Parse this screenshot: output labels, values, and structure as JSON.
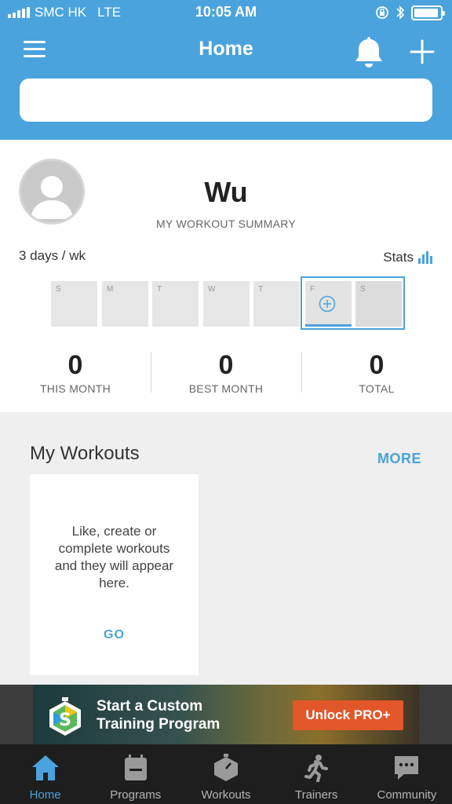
{
  "status_bar": {
    "carrier": "SMC HK",
    "network": "LTE",
    "time": "10:05 AM"
  },
  "nav": {
    "title": "Home",
    "menu_icon": "hamburger-menu-icon",
    "bell_icon": "bell-icon",
    "add_icon": "plus-icon"
  },
  "search": {
    "placeholder": ""
  },
  "profile": {
    "name": "Wu",
    "summary_label": "MY WORKOUT SUMMARY",
    "frequency": "3 days / wk",
    "stats_label": "Stats",
    "week_days": [
      "S",
      "M",
      "T",
      "W",
      "T",
      "F",
      "S"
    ],
    "metrics": [
      {
        "value": "0",
        "label": "THIS MONTH"
      },
      {
        "value": "0",
        "label": "BEST MONTH"
      },
      {
        "value": "0",
        "label": "TOTAL"
      }
    ]
  },
  "workouts": {
    "title": "My Workouts",
    "more_label": "MORE",
    "empty_text": "Like, create or complete workouts and they will appear here.",
    "go_label": "GO"
  },
  "banner": {
    "line1": "Start a Custom",
    "line2": "Training Program",
    "cta": "Unlock PRO+"
  },
  "tabs": [
    {
      "label": "Home",
      "icon": "home-icon",
      "active": true
    },
    {
      "label": "Programs",
      "icon": "calendar-icon",
      "active": false
    },
    {
      "label": "Workouts",
      "icon": "stopwatch-icon",
      "active": false
    },
    {
      "label": "Trainers",
      "icon": "runner-icon",
      "active": false
    },
    {
      "label": "Community",
      "icon": "chat-bubble-icon",
      "active": false
    }
  ],
  "colors": {
    "primary": "#4aa3dc",
    "accent": "#e2572a",
    "tabbar_bg": "#1e1e1e"
  }
}
